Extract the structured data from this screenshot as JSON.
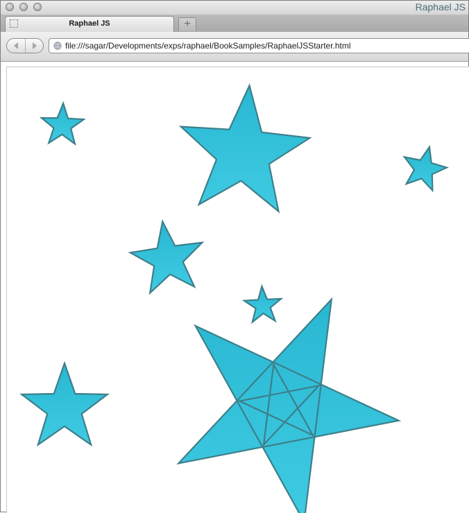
{
  "window": {
    "title": "Raphael JS"
  },
  "tabs": [
    {
      "label": "Raphael JS",
      "active": true
    }
  ],
  "toolbar": {
    "new_tab_label": "+",
    "back_icon": "chevron-left-icon",
    "forward_icon": "chevron-right-icon",
    "url": "file:///sagar/Developments/exps/raphael/BookSamples/RaphaelJSStarter.html"
  },
  "drawing": {
    "fill_top": "#29b7d2",
    "fill_bottom": "#3fcbe2",
    "stroke": "#3d7f8a",
    "shapes": [
      "star",
      "star",
      "star",
      "star",
      "star",
      "star",
      "pentagram"
    ]
  }
}
